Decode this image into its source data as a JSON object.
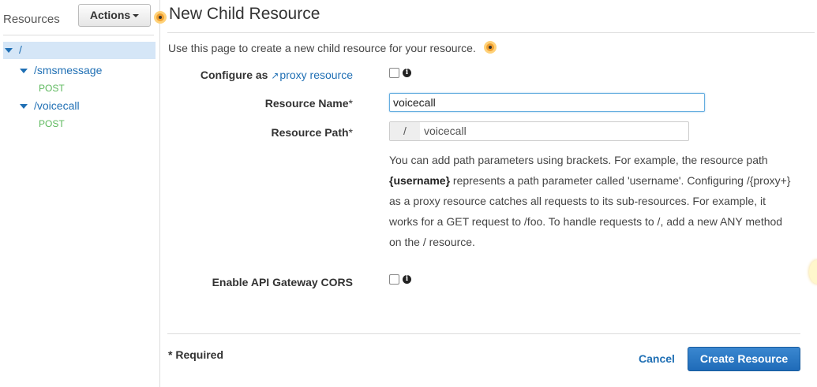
{
  "sidebar": {
    "title": "Resources",
    "actions_label": "Actions",
    "tree": [
      {
        "label": "/",
        "selected": true
      },
      {
        "label": "/smsmessage",
        "method": "POST"
      },
      {
        "label": "/voicecall",
        "method": "POST"
      }
    ]
  },
  "main": {
    "title": "New Child Resource",
    "description": "Use this page to create a new child resource for your resource.",
    "configure_prefix": "Configure as",
    "configure_link": "proxy resource",
    "resource_name_label": "Resource Name",
    "resource_name_value": "voicecall",
    "resource_path_label": "Resource Path",
    "resource_path_prefix": "/",
    "resource_path_value": "voicecall",
    "required_star": "*",
    "help_lines": [
      {
        "pre": "You can add path parameters using brackets. For example, the resource path",
        "bold": "",
        "post": ""
      },
      {
        "pre": "",
        "bold": "{username}",
        "post": " represents a path parameter called 'username'. Configuring /{proxy+}"
      },
      {
        "pre": "as a proxy resource catches all requests to its sub-resources. For example, it",
        "bold": "",
        "post": ""
      },
      {
        "pre": "works for a GET request to /foo. To handle requests to /, add a new ANY method",
        "bold": "",
        "post": ""
      },
      {
        "pre": "on the / resource.",
        "bold": "",
        "post": ""
      }
    ],
    "cors_label": "Enable API Gateway CORS",
    "info_glyph": "i",
    "required_note": "* Required",
    "cancel_label": "Cancel",
    "create_label": "Create Resource"
  },
  "colors": {
    "accent": "#1f6fb4",
    "primary_button": "#2a7ac6",
    "method_green": "#5cb85c",
    "selected_row": "#d5e6f7"
  }
}
